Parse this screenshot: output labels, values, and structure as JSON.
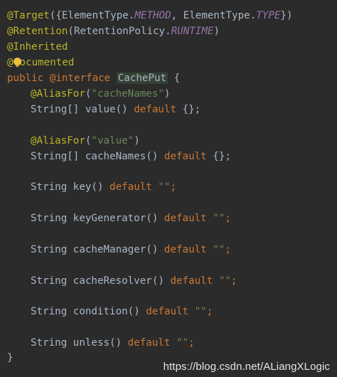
{
  "editor": {
    "lines": [
      {
        "tokens": [
          "@Target",
          "({ElementType.",
          "METHOD",
          ", ElementType.",
          "TYPE",
          "})"
        ]
      },
      {
        "tokens": [
          "@Retention",
          "(RetentionPolicy.",
          "RUNTIME",
          ")"
        ]
      },
      {
        "tokens": [
          "@Inherited"
        ]
      },
      {
        "tokens": [
          "@",
          "ocumented"
        ]
      },
      {
        "tokens": [
          "public @interface ",
          "CachePut",
          " {"
        ]
      },
      {
        "tokens": [
          "@AliasFor",
          "(",
          "\"cacheNames\"",
          ")"
        ]
      },
      {
        "tokens": [
          "String[] ",
          "value",
          "() ",
          "default",
          " {};"
        ]
      },
      {
        "tokens": [
          "@AliasFor",
          "(",
          "\"value\"",
          ")"
        ]
      },
      {
        "tokens": [
          "String[] ",
          "cacheNames",
          "() ",
          "default",
          " {};"
        ]
      },
      {
        "tokens": [
          "String ",
          "key",
          "() ",
          "default",
          " ",
          "\"\"",
          ";"
        ]
      },
      {
        "tokens": [
          "String ",
          "keyGenerator",
          "() ",
          "default",
          " ",
          "\"\"",
          ";"
        ]
      },
      {
        "tokens": [
          "String ",
          "cacheManager",
          "() ",
          "default",
          " ",
          "\"\"",
          ";"
        ]
      },
      {
        "tokens": [
          "String ",
          "cacheResolver",
          "() ",
          "default",
          " ",
          "\"\"",
          ";"
        ]
      },
      {
        "tokens": [
          "String ",
          "condition",
          "() ",
          "default",
          " ",
          "\"\"",
          ";"
        ]
      },
      {
        "tokens": [
          "String ",
          "unless",
          "() ",
          "default",
          " ",
          "\"\"",
          ";"
        ]
      },
      {
        "tokens": [
          "}"
        ]
      }
    ]
  },
  "icons": {
    "intention": "lightbulb-icon"
  },
  "watermark": {
    "text": "https://blog.csdn.net/ALiangXLogic"
  },
  "colors": {
    "background": "#2b2b2b",
    "annotation": "#bbb529",
    "keyword": "#cc7832",
    "string": "#6a8759",
    "constant": "#9876aa",
    "identifier": "#a9b7c6",
    "declaration_highlight": "#344134",
    "bulb": "#f0c03c"
  }
}
